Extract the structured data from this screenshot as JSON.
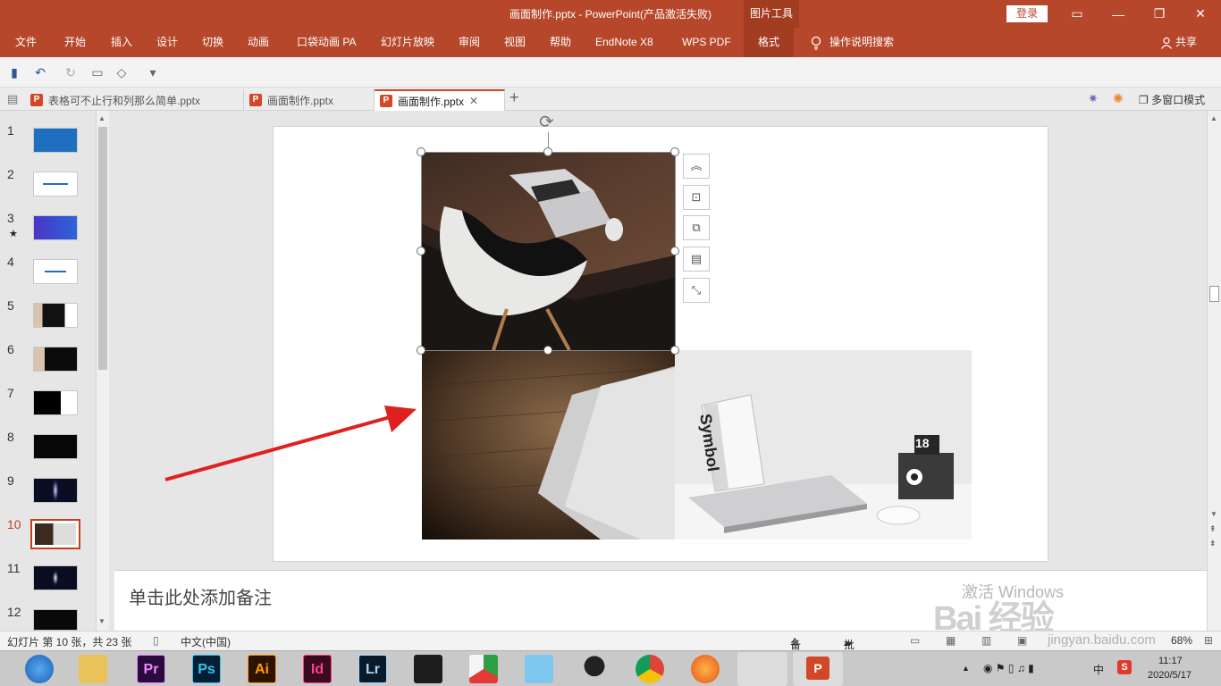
{
  "window": {
    "title": "画面制作.pptx  -  PowerPoint(产品激活失败)",
    "context_tab": "图片工具",
    "login_label": "登录",
    "controls": {
      "restore_ribbon": "▭",
      "minimize": "—",
      "maximize": "❐",
      "close": "✕"
    }
  },
  "ribbon": {
    "tabs": [
      "文件",
      "开始",
      "插入",
      "设计",
      "切换",
      "动画",
      "口袋动画 PA",
      "幻灯片放映",
      "审阅",
      "视图",
      "帮助",
      "EndNote X8",
      "WPS PDF",
      "格式"
    ],
    "active_tab": "格式",
    "tell_me": "操作说明搜索",
    "share": "共享"
  },
  "qat": {
    "save": "▮",
    "undo": "↶",
    "redo": "↻",
    "present": "▭",
    "shape": "◇",
    "more": "▾"
  },
  "doc_tabs": [
    {
      "label": "表格可不止行和列那么简单.pptx",
      "active": false
    },
    {
      "label": "画面制作.pptx",
      "active": false
    },
    {
      "label": "画面制作.pptx",
      "active": true
    }
  ],
  "doc_tab_icon": "P",
  "doc_tab_close": "✕",
  "doc_tab_add": "+",
  "multi_window": "多窗口模式",
  "thumbnails": {
    "slides": [
      {
        "num": "1",
        "star": ""
      },
      {
        "num": "2",
        "star": ""
      },
      {
        "num": "3",
        "star": "★"
      },
      {
        "num": "4",
        "star": ""
      },
      {
        "num": "5",
        "star": ""
      },
      {
        "num": "6",
        "star": ""
      },
      {
        "num": "7",
        "star": ""
      },
      {
        "num": "8",
        "star": ""
      },
      {
        "num": "9",
        "star": ""
      },
      {
        "num": "10",
        "star": ""
      },
      {
        "num": "11",
        "star": ""
      },
      {
        "num": "12",
        "star": ""
      }
    ],
    "active": "10"
  },
  "photo_labels": {
    "book": "Symbol",
    "calendar": "18"
  },
  "side_buttons": [
    "︽",
    "⊡",
    "⧉",
    "▤",
    "⤡"
  ],
  "rotate_handle": "⟳",
  "notes_placeholder": "单击此处添加备注",
  "status": {
    "slide_info": "幻灯片 第 10 张，共 23 张",
    "language": "中文(中国)",
    "notes": "备注",
    "comments": "批注",
    "zoom": "68%"
  },
  "watermark": {
    "activate": "激活 Windows",
    "site": "jingyan.baidu.com",
    "brand": "Bai  经验"
  },
  "taskbar": {
    "apps": [
      "Pr",
      "Ps",
      "Ai",
      "Id",
      "Lr"
    ],
    "tray_ime": "中",
    "tray_s": "S",
    "time": "11:17",
    "date": "2020/5/17"
  }
}
